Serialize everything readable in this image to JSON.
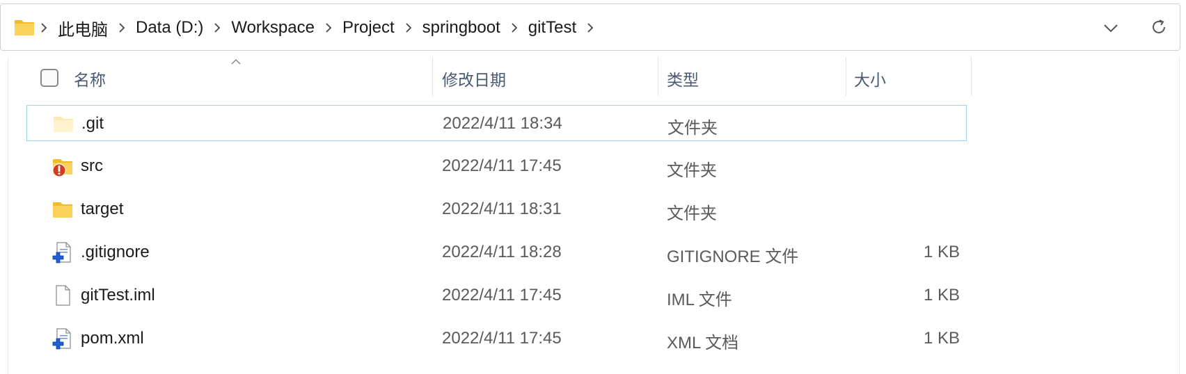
{
  "address_bar": {
    "crumbs": [
      "此电脑",
      "Data (D:)",
      "Workspace",
      "Project",
      "springboot",
      "gitTest"
    ]
  },
  "columns": {
    "name": "名称",
    "modified": "修改日期",
    "type": "类型",
    "size": "大小"
  },
  "files": [
    {
      "name": ".git",
      "modified": "2022/4/11 18:34",
      "type": "文件夹",
      "size": "",
      "icon": "folder-hidden-icon"
    },
    {
      "name": "src",
      "modified": "2022/4/11 17:45",
      "type": "文件夹",
      "size": "",
      "icon": "folder-error-icon"
    },
    {
      "name": "target",
      "modified": "2022/4/11 18:31",
      "type": "文件夹",
      "size": "",
      "icon": "folder-icon"
    },
    {
      "name": ".gitignore",
      "modified": "2022/4/11 18:28",
      "type": "GITIGNORE 文件",
      "size": "1 KB",
      "icon": "file-tortoise-icon"
    },
    {
      "name": "gitTest.iml",
      "modified": "2022/4/11 17:45",
      "type": "IML 文件",
      "size": "1 KB",
      "icon": "blank-file-icon"
    },
    {
      "name": "pom.xml",
      "modified": "2022/4/11 17:45",
      "type": "XML 文档",
      "size": "1 KB",
      "icon": "file-tortoise-icon"
    }
  ],
  "colors": {
    "folder": "#f8c94a",
    "selection_border": "#99d1ee",
    "header_text": "#4a5a72",
    "error_badge": "#d23c20",
    "added_badge": "#1f5fd6"
  }
}
